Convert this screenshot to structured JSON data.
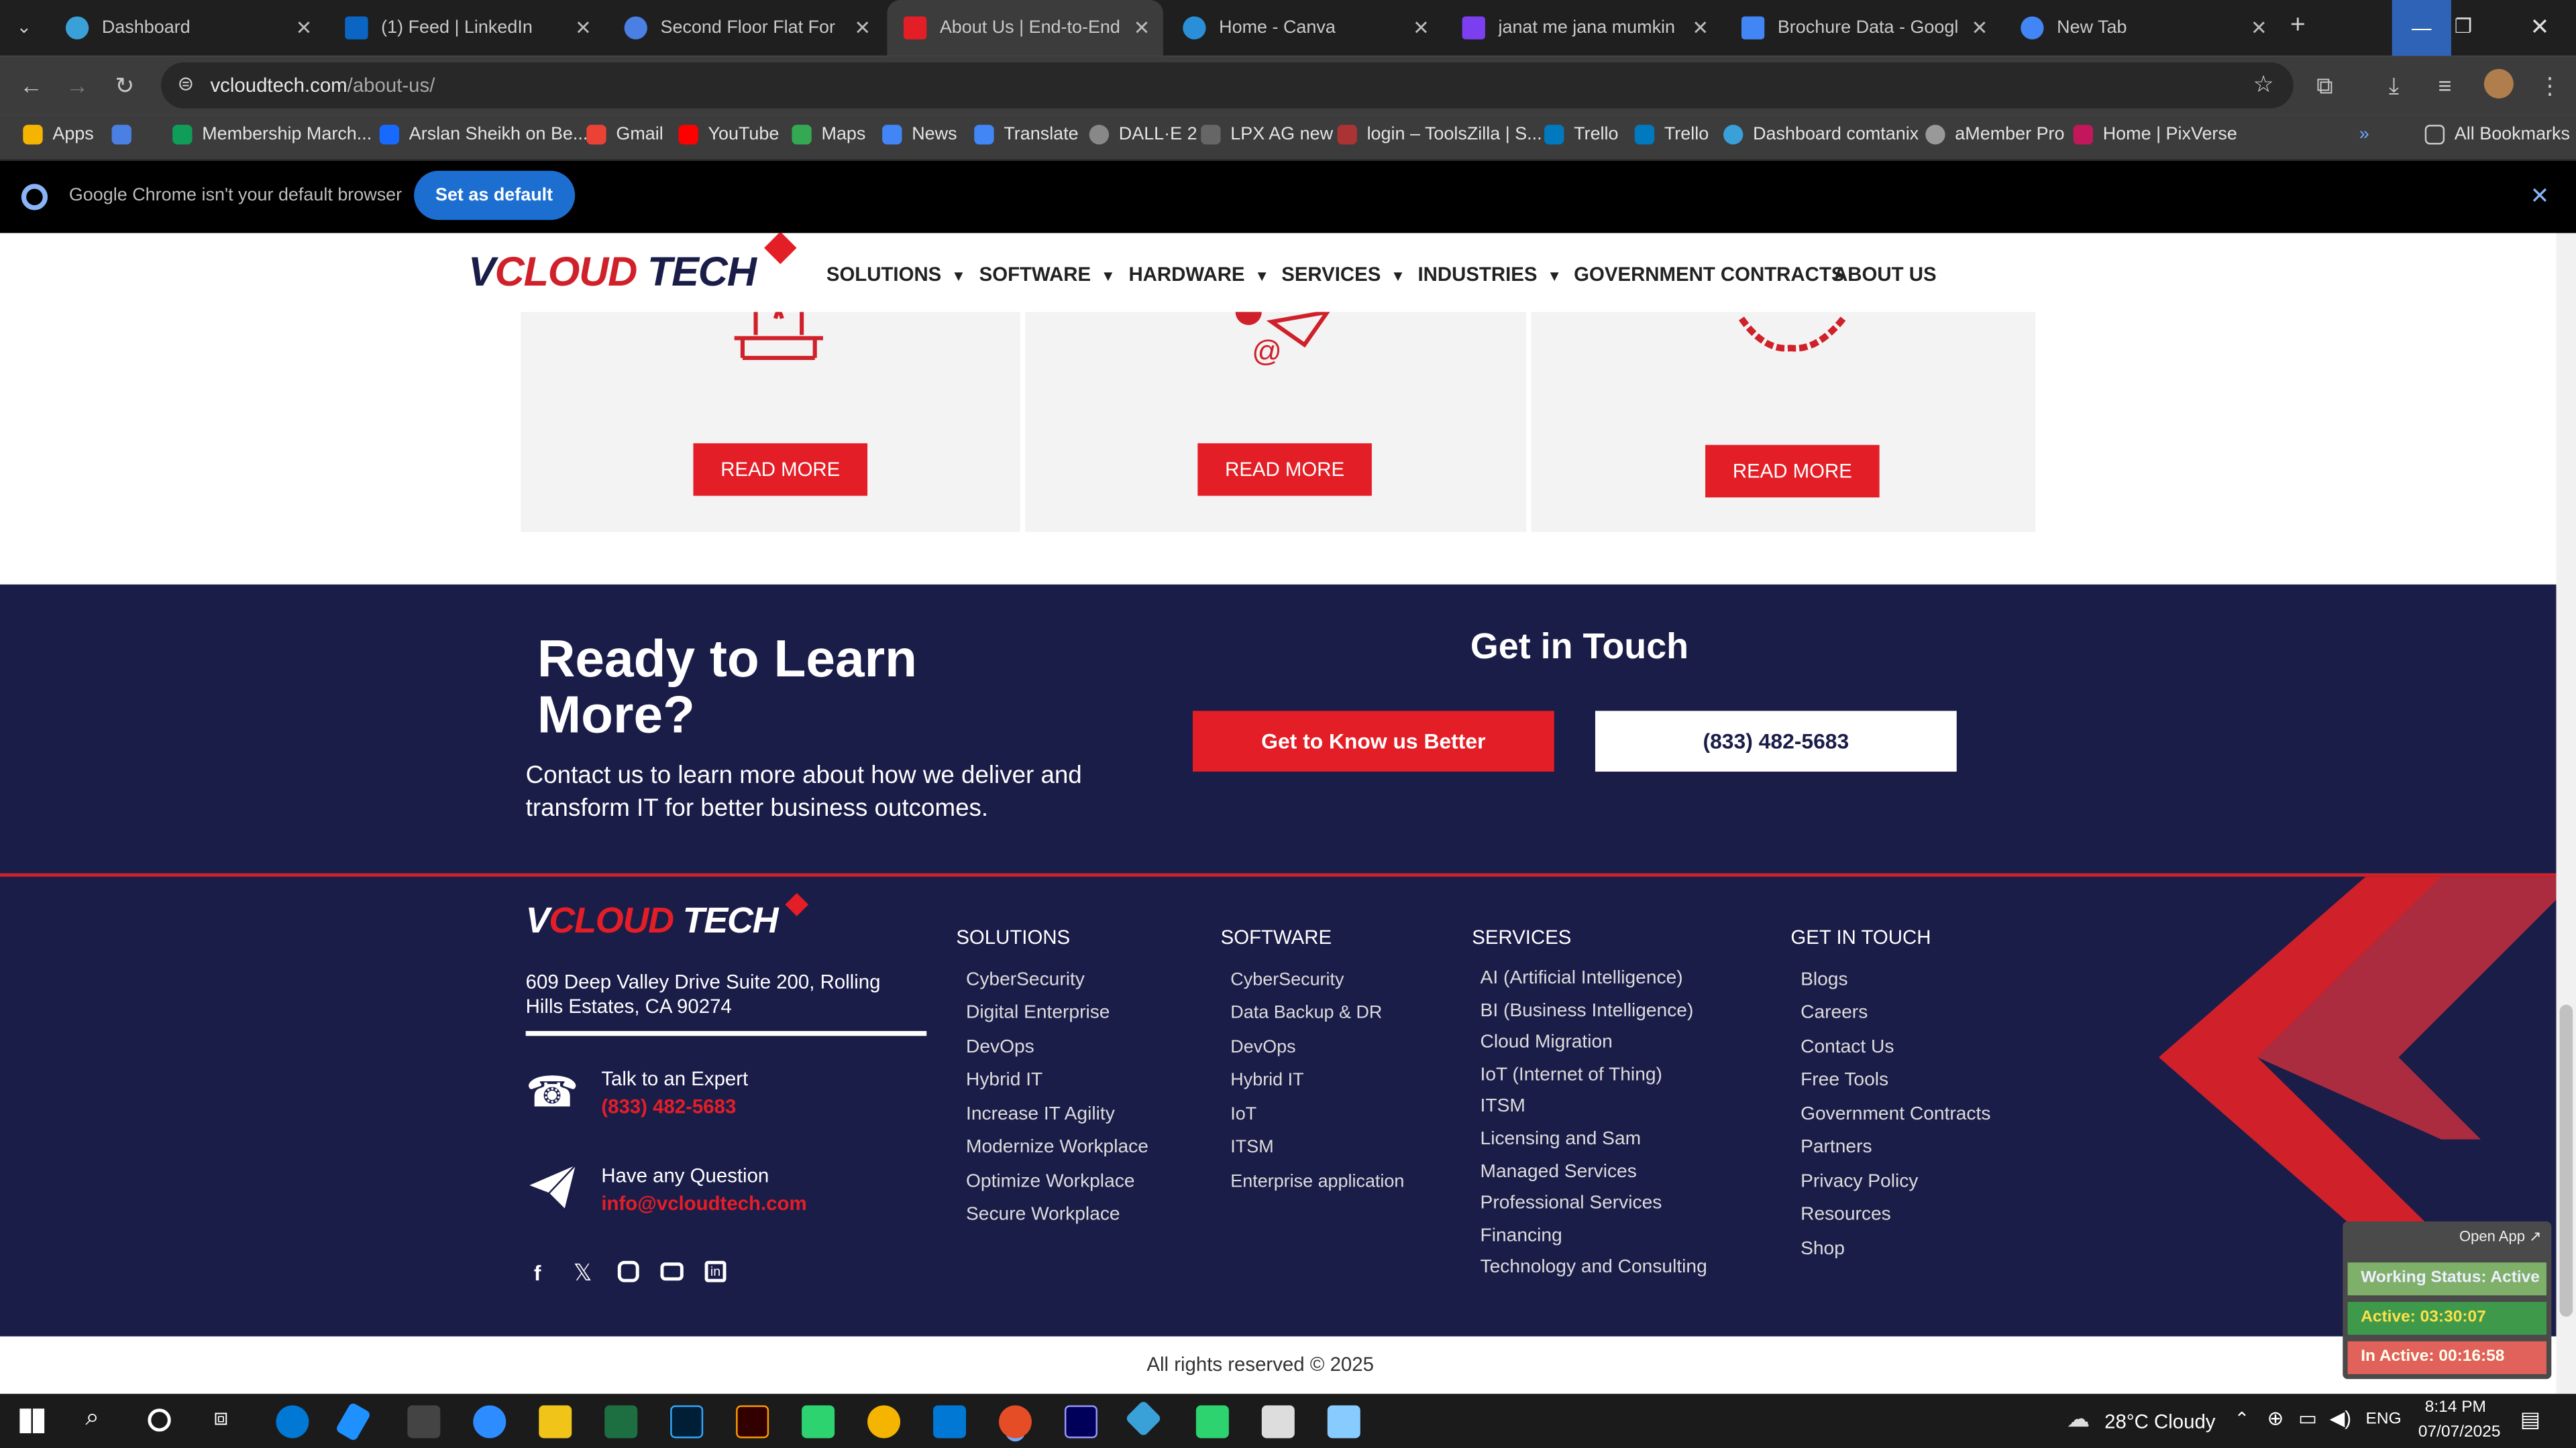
{
  "browser": {
    "tabs": [
      {
        "title": "Dashboard",
        "color": "#3aa0d8"
      },
      {
        "title": "(1) Feed | LinkedIn",
        "color": "#0a66c2"
      },
      {
        "title": "Second Floor Flat For Ren",
        "color": "#4a7fe3"
      },
      {
        "title": "About Us | End-to-End IT",
        "color": "#e41e26"
      },
      {
        "title": "Home - Canva",
        "color": "#2a8fd6"
      },
      {
        "title": "janat me jana mumkin na",
        "color": "#7b3ff0"
      },
      {
        "title": "Brochure Data - Google D",
        "color": "#4285f4"
      },
      {
        "title": "New Tab",
        "color": "#4285f4"
      }
    ],
    "url_host": "vcloudtech.com",
    "url_path": "/about-us/",
    "bookmarks": [
      {
        "label": "Apps",
        "color": "#f4b400"
      },
      {
        "label": "Membership March...",
        "color": "#0f9d58"
      },
      {
        "label": "Arslan Sheikh on Be...",
        "color": "#1769ff"
      },
      {
        "label": "Gmail",
        "color": "#ea4335"
      },
      {
        "label": "YouTube",
        "color": "#ff0000"
      },
      {
        "label": "Maps",
        "color": "#34a853"
      },
      {
        "label": "News",
        "color": "#4285f4"
      },
      {
        "label": "Translate",
        "color": "#4285f4"
      },
      {
        "label": "DALL·E 2",
        "color": "#888888"
      },
      {
        "label": "LPX AG new",
        "color": "#666666"
      },
      {
        "label": "login – ToolsZilla | S...",
        "color": "#a33"
      },
      {
        "label": "Trello",
        "color": "#0079bf"
      },
      {
        "label": "Trello",
        "color": "#0079bf"
      },
      {
        "label": "Dashboard comtanix",
        "color": "#3aa0d8"
      },
      {
        "label": "aMember Pro",
        "color": "#999999"
      },
      {
        "label": "Home | PixVerse",
        "color": "#c2185b"
      }
    ],
    "all_bookmarks": "All Bookmarks",
    "infobar_text": "Google Chrome isn't your default browser",
    "infobar_button": "Set as default"
  },
  "site": {
    "logo_v": "V",
    "logo_cloud": "CLOUD",
    "logo_tech": " TECH",
    "nav": [
      {
        "label": "SOLUTIONS",
        "dropdown": true
      },
      {
        "label": "SOFTWARE",
        "dropdown": true
      },
      {
        "label": "HARDWARE",
        "dropdown": true
      },
      {
        "label": "SERVICES",
        "dropdown": true
      },
      {
        "label": "INDUSTRIES",
        "dropdown": true
      },
      {
        "label": "GOVERNMENT CONTRACTS",
        "dropdown": false
      },
      {
        "label": "ABOUT US",
        "dropdown": false
      }
    ],
    "cards": [
      {
        "button": "READ MORE",
        "icon": "desk-icon"
      },
      {
        "button": "READ MORE",
        "icon": "email-send-icon"
      },
      {
        "button": "READ MORE",
        "icon": "handshake-icon"
      }
    ],
    "cta": {
      "heading": "Ready to Learn More?",
      "body": "Contact us to learn more about how we deliver and transform IT for better business outcomes.",
      "touch_heading": "Get in Touch",
      "primary_button": "Get to Know us Better",
      "phone_button": "(833) 482-5683"
    },
    "footer": {
      "address": "609 Deep Valley Drive Suite 200, Rolling Hills Estates, CA 90274",
      "expert_label": "Talk to an Expert",
      "expert_phone": "(833) 482-5683",
      "question_label": "Have any Question",
      "email": "info@vcloudtech.com",
      "columns": [
        {
          "title": "SOLUTIONS",
          "links": [
            "CyberSecurity",
            "Digital Enterprise",
            "DevOps",
            "Hybrid IT",
            "Increase IT Agility",
            "Modernize Workplace",
            "Optimize Workplace",
            "Secure Workplace"
          ]
        },
        {
          "title": "SOFTWARE",
          "links": [
            "CyberSecurity",
            "Data Backup & DR",
            "DevOps",
            "Hybrid IT",
            "IoT",
            "ITSM",
            "Enterprise application"
          ]
        },
        {
          "title": "SERVICES",
          "links": [
            "AI (Artificial Intelligence)",
            "BI (Business Intelligence)",
            "Cloud Migration",
            "IoT (Internet of Thing)",
            "ITSM",
            "Licensing and Sam",
            "Managed Services",
            "Professional Services",
            "Financing",
            "Technology and Consulting"
          ]
        },
        {
          "title": "GET IN TOUCH",
          "links": [
            "Blogs",
            "Careers",
            "Contact Us",
            "Free Tools",
            "Government Contracts",
            "Partners",
            "Privacy Policy",
            "Resources",
            "Shop"
          ]
        }
      ],
      "copyright": "All rights reserved © 2025"
    }
  },
  "widget": {
    "open_app": "Open App ↗",
    "status": "Working Status: Active",
    "active": "Active: 03:30:07",
    "inactive": "In Active: 00:16:58"
  },
  "taskbar": {
    "weather": "28°C  Cloudy",
    "lang": "ENG",
    "time": "8:14 PM",
    "date": "07/07/2025",
    "apps": [
      "#0078d4",
      "#1e90ff",
      "#444444",
      "#2d8cff",
      "#f0c419",
      "#1d6f42",
      "#31a8ff",
      "#ff3d00",
      "#2dd36f",
      "#f4b400",
      "#0078d4",
      "#e44d26",
      "#9999ff",
      "#3aa0d8",
      "#2dd36f",
      "#dddddd",
      "#88ccff"
    ]
  }
}
